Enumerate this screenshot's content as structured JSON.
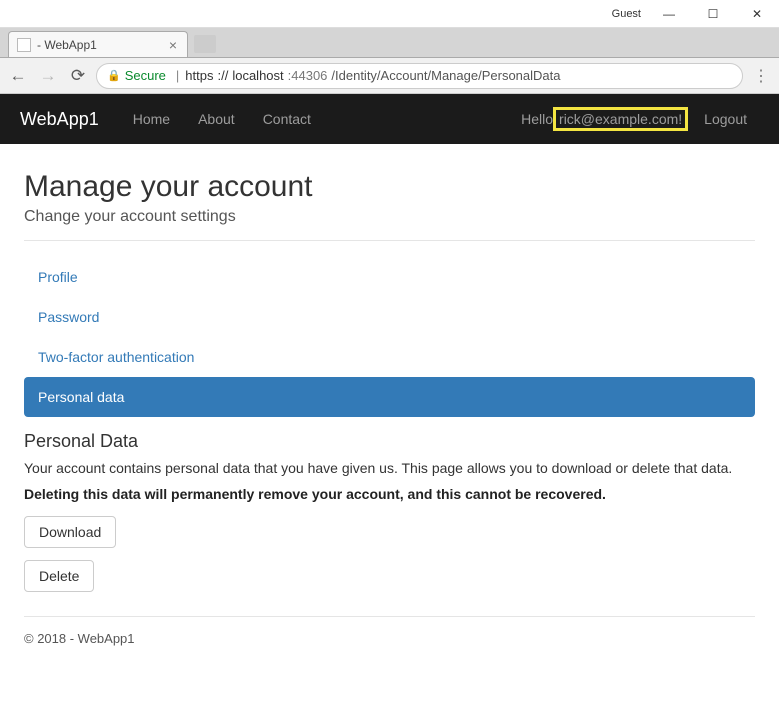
{
  "window": {
    "guest_label": "Guest"
  },
  "browser": {
    "tab_title": " - WebApp1",
    "secure_label": "Secure",
    "url_scheme": "https",
    "url_host": "localhost",
    "url_port": ":44306",
    "url_path": "/Identity/Account/Manage/PersonalData"
  },
  "nav": {
    "brand": "WebApp1",
    "links": {
      "home": "Home",
      "about": "About",
      "contact": "Contact"
    },
    "hello_prefix": "Hello ",
    "email": "rick@example.com!",
    "logout": "Logout"
  },
  "page": {
    "title": "Manage your account",
    "subtitle": "Change your account settings",
    "manage_nav": {
      "profile": "Profile",
      "password": "Password",
      "twofactor": "Two-factor authentication",
      "personal_data": "Personal data"
    },
    "section": {
      "heading": "Personal Data",
      "body": "Your account contains personal data that you have given us. This page allows you to download or delete that data.",
      "warning": "Deleting this data will permanently remove your account, and this cannot be recovered.",
      "download_btn": "Download",
      "delete_btn": "Delete"
    },
    "footer": "© 2018 - WebApp1"
  }
}
